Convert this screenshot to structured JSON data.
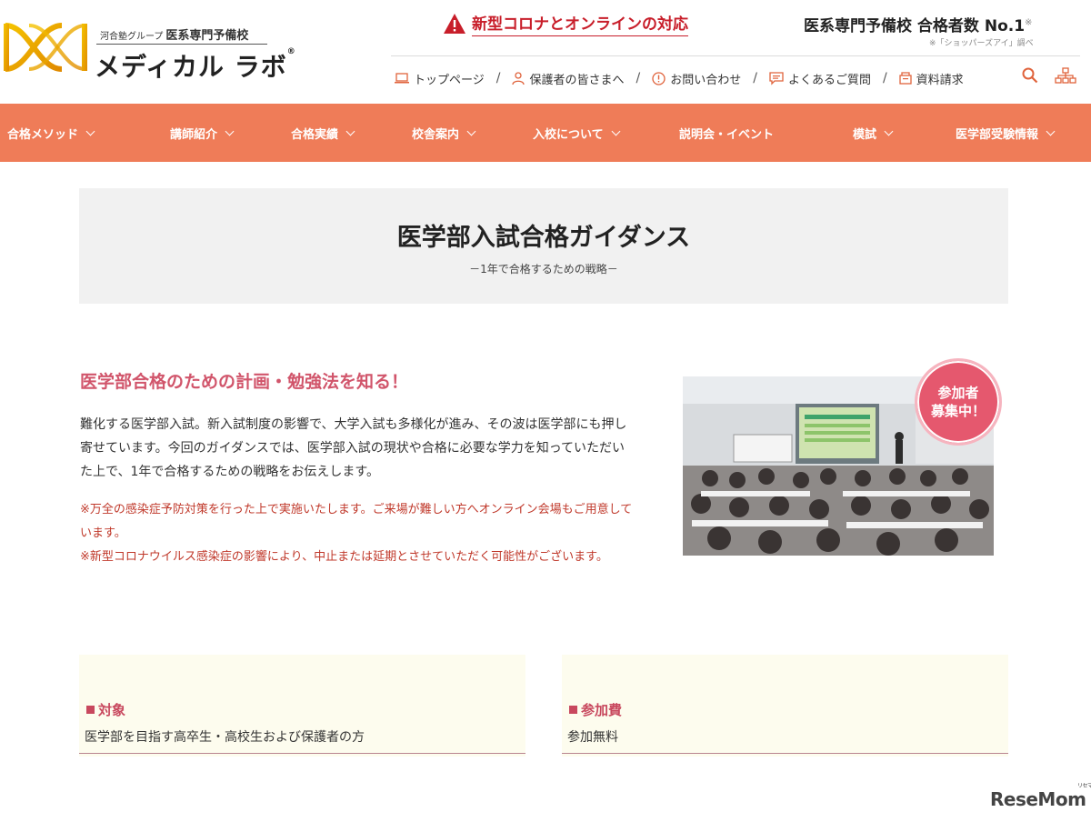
{
  "header": {
    "logo": {
      "group": "河合塾グループ",
      "school": "医系専門予備校",
      "name": "メディカル ラボ",
      "reg": "®"
    },
    "covid_notice": "新型コロナとオンラインの対応",
    "no1": {
      "text": "医系専門予備校 合格者数 No.1",
      "mark": "※",
      "note": "※「ショッパーズアイ」調べ"
    },
    "util_nav": [
      {
        "label": "トップページ",
        "icon": "laptop-icon"
      },
      {
        "label": "保護者の皆さまへ",
        "icon": "person-icon"
      },
      {
        "label": "お問い合わせ",
        "icon": "info-icon"
      },
      {
        "label": "よくあるご質問",
        "icon": "chat-icon"
      },
      {
        "label": "資料請求",
        "icon": "document-icon"
      }
    ],
    "util_sep": "/"
  },
  "main_nav": [
    {
      "label": "合格メソッド"
    },
    {
      "label": "講師紹介"
    },
    {
      "label": "合格実績"
    },
    {
      "label": "校舎案内"
    },
    {
      "label": "入校について"
    },
    {
      "label": "説明会・イベント"
    },
    {
      "label": "模試"
    },
    {
      "label": "医学部受験情報"
    }
  ],
  "page": {
    "title": "医学部入試合格ガイダンス",
    "subtitle": "－1年で合格するための戦略－"
  },
  "intro": {
    "heading": "医学部合格のための計画・勉強法を知る！",
    "body": "難化する医学部入試。新入試制度の影響で、大学入試も多様化が進み、その波は医学部にも押し寄せています。今回のガイダンスでは、医学部入試の現状や合格に必要な学力を知っていただいた上で、1年で合格するための戦略をお伝えします。",
    "note1": "※万全の感染症予防対策を行った上で実施いたします。ご来場が難しい方へオンライン会場もご用意しています。",
    "note2": "※新型コロナウイルス感染症の影響により、中止または延期とさせていただく可能性がございます。"
  },
  "badge": {
    "line1": "参加者",
    "line2": "募集中！"
  },
  "info": {
    "target_label": "対象",
    "target_value": "医学部を目指す高卒生・高校生および保護者の方",
    "fee_label": "参加費",
    "fee_value": "参加無料"
  },
  "watermark": {
    "text": "ReseMom",
    "kana": "リセマム"
  },
  "colors": {
    "nav": "#ef7c58",
    "heading": "#d1556b",
    "notice": "#c81e2a",
    "badge": "#e5586e"
  }
}
